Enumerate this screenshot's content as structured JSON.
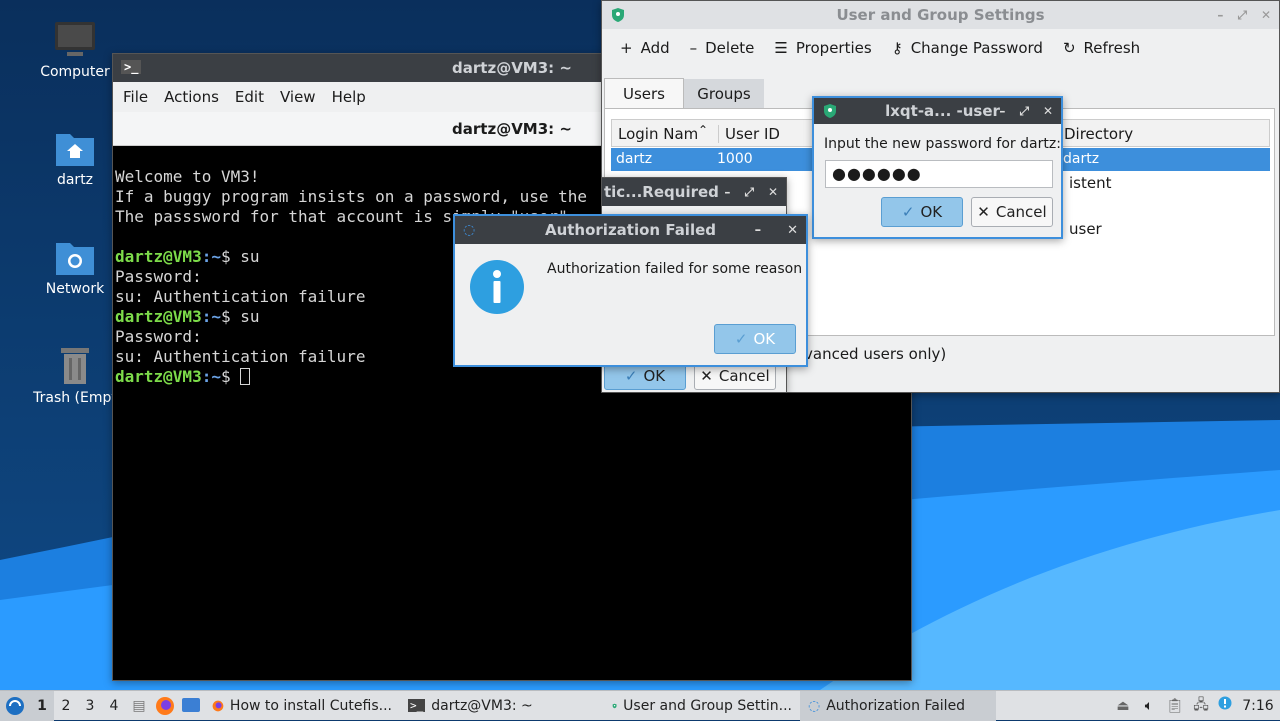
{
  "desktop": {
    "icons": [
      {
        "label": "Computer",
        "icon": "computer-icon"
      },
      {
        "label": "dartz",
        "icon": "home-folder-icon"
      },
      {
        "label": "Network",
        "icon": "network-folder-icon"
      },
      {
        "label": "Trash (Empt",
        "icon": "trash-icon"
      }
    ]
  },
  "terminal": {
    "title": "dartz@VM3: ~",
    "tab_title": "dartz@VM3: ~",
    "menu": [
      "File",
      "Actions",
      "Edit",
      "View",
      "Help"
    ],
    "lines": {
      "l1": "Welcome to VM3!",
      "l2": "If a buggy program insists on a password, use the",
      "l3": "The passsword for that account is simply \"user\".",
      "p_user": "dartz@VM3",
      "p_path": ":~",
      "p_sign": "$ ",
      "cmd1": "su",
      "pw": "Password:",
      "fail": "su: Authentication failure",
      "cmd2": "su"
    }
  },
  "user_group_settings": {
    "title": "User and Group Settings",
    "toolbar": {
      "add": "Add",
      "delete": "Delete",
      "properties": "Properties",
      "change_password": "Change Password",
      "refresh": "Refresh"
    },
    "tabs": {
      "users": "Users",
      "groups": "Groups"
    },
    "columns": {
      "login": "Login Nam",
      "uid": "User ID",
      "home": "Directory"
    },
    "rows": [
      {
        "login": "dartz",
        "uid": "1000",
        "home": "dartz"
      },
      {
        "login": "",
        "uid": "",
        "home": "istent"
      },
      {
        "login": "",
        "uid": "",
        "home": ""
      },
      {
        "login": "",
        "uid": "",
        "home": "user"
      }
    ],
    "bottom_text": "vanced users only)"
  },
  "auth_required": {
    "title": "tic...Required",
    "ok": "OK",
    "cancel": "Cancel"
  },
  "password_dialog": {
    "title": "lxqt-a... -user",
    "prompt": "Input the new password for dartz:",
    "value": "●●●●●●",
    "ok": "OK",
    "cancel": "Cancel"
  },
  "auth_failed": {
    "title": "Authorization Failed",
    "message": "Authorization failed for some reason",
    "ok": "OK"
  },
  "taskbar": {
    "workspaces": [
      "1",
      "2",
      "3",
      "4"
    ],
    "tasks": [
      {
        "label": "How to install Cutefis..."
      },
      {
        "label": "dartz@VM3: ~"
      },
      {
        "label": "User and Group Settin..."
      },
      {
        "label": "Authorization Failed"
      }
    ],
    "clock": "7:16"
  },
  "colors": {
    "accent": "#93c6ea",
    "selection": "#3d8fdc",
    "desktop": "#0d3a6e"
  }
}
